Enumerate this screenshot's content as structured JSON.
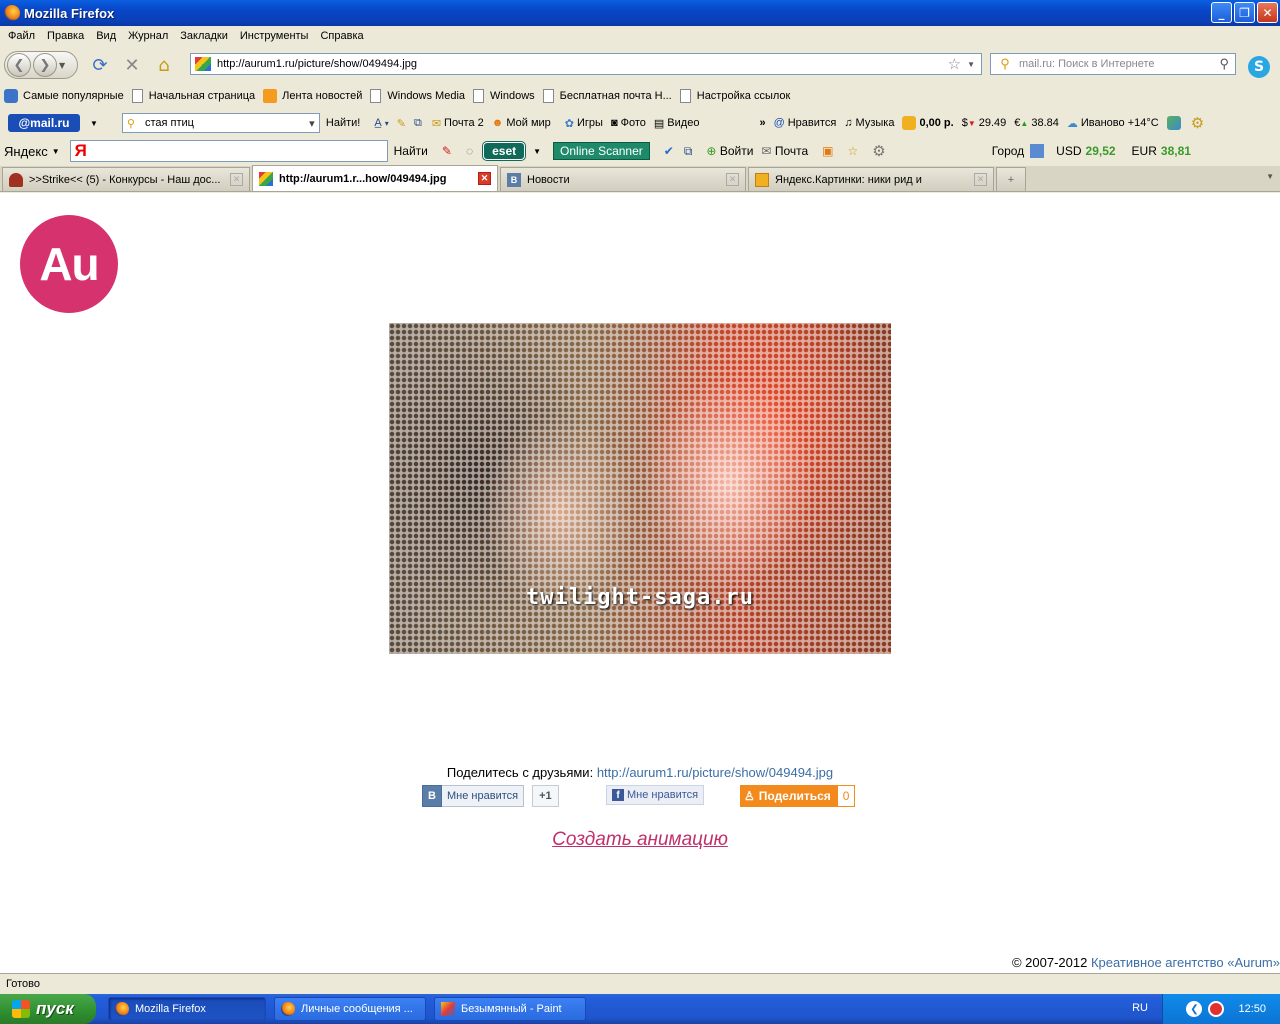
{
  "window": {
    "title": "Mozilla Firefox"
  },
  "menu": [
    "Файл",
    "Правка",
    "Вид",
    "Журнал",
    "Закладки",
    "Инструменты",
    "Справка"
  ],
  "nav": {
    "url": "http://aurum1.ru/picture/show/049494.jpg",
    "search_placeholder": "mail.ru: Поиск в Интернете"
  },
  "bookmarks": [
    "Самые популярные",
    "Начальная страница",
    "Лента новостей",
    "Windows Media",
    "Windows",
    "Бесплатная почта Н...",
    "Настройка ссылок"
  ],
  "mailru": {
    "logo": "@mail.ru",
    "search_value": "стая птиц",
    "find": "Найти!",
    "mail": "Почта 2",
    "myworld": "Мой мир",
    "games": "Игры",
    "photo": "Фото",
    "video": "Видео",
    "more": "»",
    "like": "Нравится",
    "music": "Музыка",
    "balance": "0,00 р.",
    "usd": "29.49",
    "eur": "38.84",
    "weather": "Иваново +14°C"
  },
  "yandex": {
    "label": "Яндекс",
    "logo_letter": "Я",
    "find": "Найти",
    "eset": "eset",
    "online_scanner": "Online Scanner",
    "login": "Войти",
    "mail": "Почта",
    "city": "Город",
    "usd_label": "USD",
    "usd_value": "29,52",
    "eur_label": "EUR",
    "eur_value": "38,81"
  },
  "tabs": [
    {
      "label": ">>Strike<< (5) - Конкурсы - Наш дос...",
      "active": false
    },
    {
      "label": "http://aurum1.r...how/049494.jpg",
      "active": true
    },
    {
      "label": "Новости",
      "active": false
    },
    {
      "label": "Яндекс.Картинки: ники рид и",
      "active": false
    }
  ],
  "page": {
    "logo": "Au",
    "watermark": "twilight-saga.ru",
    "share_label": "Поделитесь с друзьями:",
    "share_url": "http://aurum1.ru/picture/show/049494.jpg",
    "vk_letter": "B",
    "vk_like": "Мне нравится",
    "vk_plus": "+1",
    "fb_like": "Мне нравится",
    "ok_share": "Поделиться",
    "ok_count": "0",
    "create_animation": "Создать анимацию",
    "copyright": "© 2007-2012",
    "agency": "Креативное агентство «Aurum»"
  },
  "status": {
    "text": "Готово"
  },
  "taskbar": {
    "start": "пуск",
    "tasks": [
      "Mozilla Firefox",
      "Личные сообщения ...",
      "Безымянный - Paint"
    ],
    "lang": "RU",
    "time": "12:50"
  }
}
